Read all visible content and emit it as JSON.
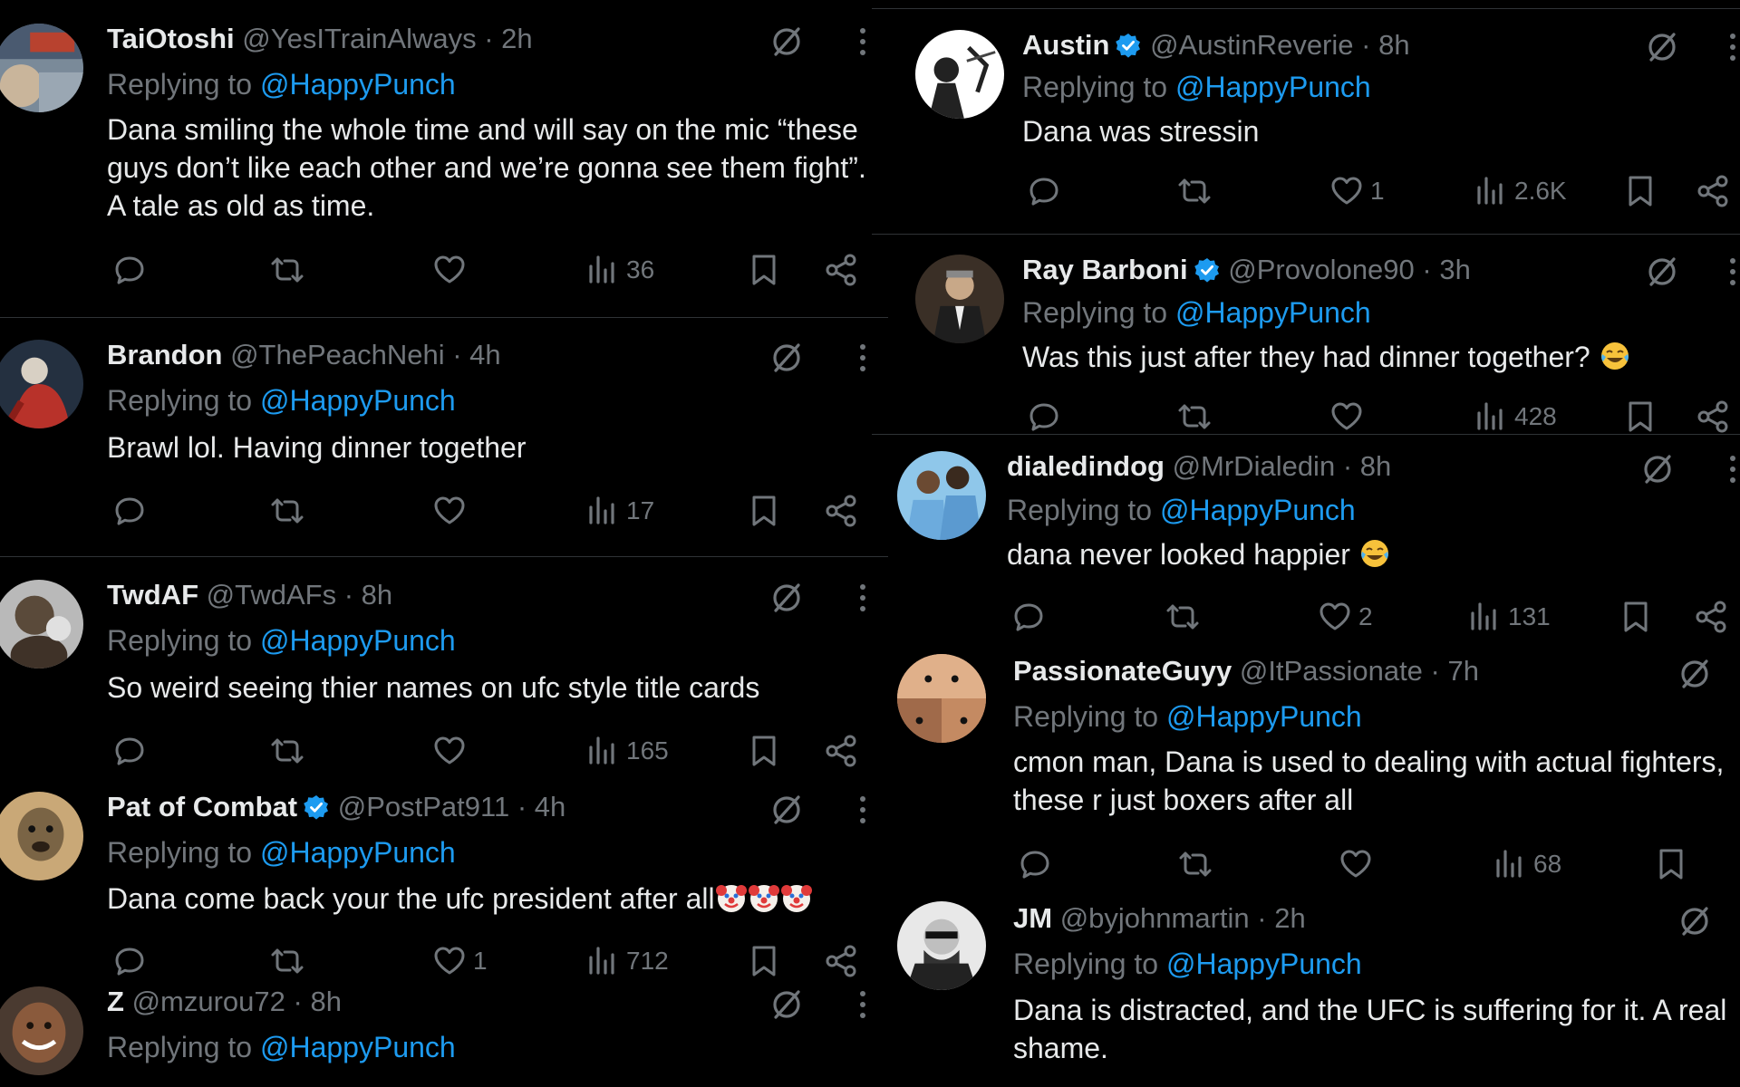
{
  "left_column": [
    {
      "name": "TaiOtoshi",
      "verified": false,
      "handle": "@YesITrainAlways",
      "time": "· 2h",
      "replying_label": "Replying to",
      "mention": "@HappyPunch",
      "text_lines": [
        "Dana smiling the whole time and will say on the mic “these",
        "guys don’t like each other and we’re gonna see them fight”.",
        "A tale as old as time."
      ],
      "likes": "",
      "views": "36"
    },
    {
      "name": "Brandon",
      "verified": false,
      "handle": "@ThePeachNehi",
      "time": "· 4h",
      "replying_label": "Replying to",
      "mention": "@HappyPunch",
      "text_lines": [
        "Brawl lol. Having dinner together"
      ],
      "likes": "",
      "views": "17"
    },
    {
      "name": "TwdAF",
      "verified": false,
      "handle": "@TwdAFs",
      "time": "· 8h",
      "replying_label": "Replying to",
      "mention": "@HappyPunch",
      "text_lines": [
        "So weird seeing thier names on ufc style title cards"
      ],
      "likes": "",
      "views": "165"
    },
    {
      "name": "Pat of Combat",
      "verified": true,
      "handle": "@PostPat911",
      "time": "· 4h",
      "replying_label": "Replying to",
      "mention": "@HappyPunch",
      "text_lines": [
        "Dana come back your the ufc president after all"
      ],
      "emojis": [
        "clown-face",
        "clown-face",
        "clown-face"
      ],
      "likes": "1",
      "views": "712"
    },
    {
      "name": "Z",
      "verified": false,
      "handle": "@mzurou72",
      "time": "· 8h",
      "replying_label": "Replying to",
      "mention": "@HappyPunch",
      "text_lines": [],
      "likes": "",
      "views": ""
    }
  ],
  "right_column": [
    {
      "name": "Austin",
      "verified": true,
      "handle": "@AustinReverie",
      "time": "· 8h",
      "replying_label": "Replying to",
      "mention": "@HappyPunch",
      "text_lines": [
        "Dana was stressin"
      ],
      "likes": "1",
      "views": "2.6K"
    },
    {
      "name": "Ray Barboni",
      "verified": true,
      "handle": "@Provolone90",
      "time": "· 3h",
      "replying_label": "Replying to",
      "mention": "@HappyPunch",
      "text_lines": [
        "Was this just after they had dinner together? "
      ],
      "emojis": [
        "laughing-tears"
      ],
      "likes": "",
      "views": "428"
    },
    {
      "name": "dialedindog",
      "verified": false,
      "handle": "@MrDialedin",
      "time": "· 8h",
      "replying_label": "Replying to",
      "mention": "@HappyPunch",
      "text_lines": [
        "dana never looked happier "
      ],
      "emojis": [
        "laughing-tears"
      ],
      "likes": "2",
      "views": "131"
    },
    {
      "name": "PassionateGuyy",
      "verified": false,
      "handle": "@ItPassionate",
      "time": "· 7h",
      "replying_label": "Replying to",
      "mention": "@HappyPunch",
      "text_lines": [
        "cmon man, Dana is used to dealing with actual fighters,",
        "these r just boxers after all"
      ],
      "likes": "",
      "views": "68"
    },
    {
      "name": "JM",
      "verified": false,
      "handle": "@byjohnmartin",
      "time": "· 2h",
      "replying_label": "Replying to",
      "mention": "@HappyPunch",
      "text_lines": [
        "Dana is distracted, and the UFC is suffering for it. A real",
        "shame."
      ],
      "likes": "",
      "views": ""
    }
  ],
  "colors": {
    "background": "#000000",
    "text": "#e7e9ea",
    "muted": "#71767b",
    "link": "#1d9bf0",
    "separator": "#2f3336",
    "verified": "#1d9bf0"
  },
  "icons": [
    "reply-icon",
    "retweet-icon",
    "like-icon",
    "views-icon",
    "bookmark-icon",
    "share-icon",
    "grok-icon",
    "more-icon",
    "verified-badge-icon"
  ]
}
